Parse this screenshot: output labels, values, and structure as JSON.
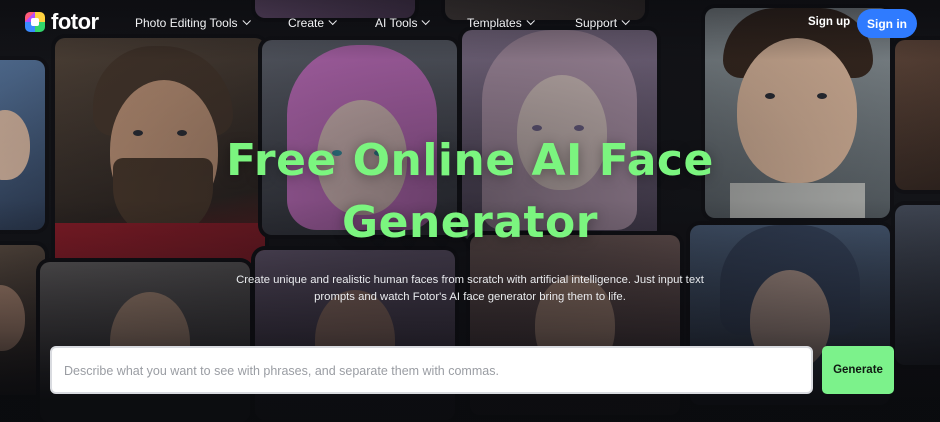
{
  "brand": {
    "name": "fotor"
  },
  "nav": {
    "items": [
      {
        "label": "Photo Editing Tools"
      },
      {
        "label": "Create"
      },
      {
        "label": "AI Tools"
      },
      {
        "label": "Templates"
      },
      {
        "label": "Support"
      }
    ],
    "signup_label": "Sign up",
    "signin_label": "Sign in"
  },
  "hero": {
    "title_line1": "Free Online AI Face",
    "title_line2": "Generator",
    "subtitle_line1": "Create unique and realistic human faces from scratch with artificial intelligence. Just input text",
    "subtitle_line2": "prompts and watch Fotor's AI face generator bring them to life."
  },
  "prompt": {
    "placeholder": "Describe what you want to see with phrases, and separate them with commas.",
    "value": "",
    "generate_label": "Generate"
  },
  "colors": {
    "title_green": "#7bf57f",
    "generate_green": "#7cf28b",
    "signin_blue": "#2f7bff"
  }
}
